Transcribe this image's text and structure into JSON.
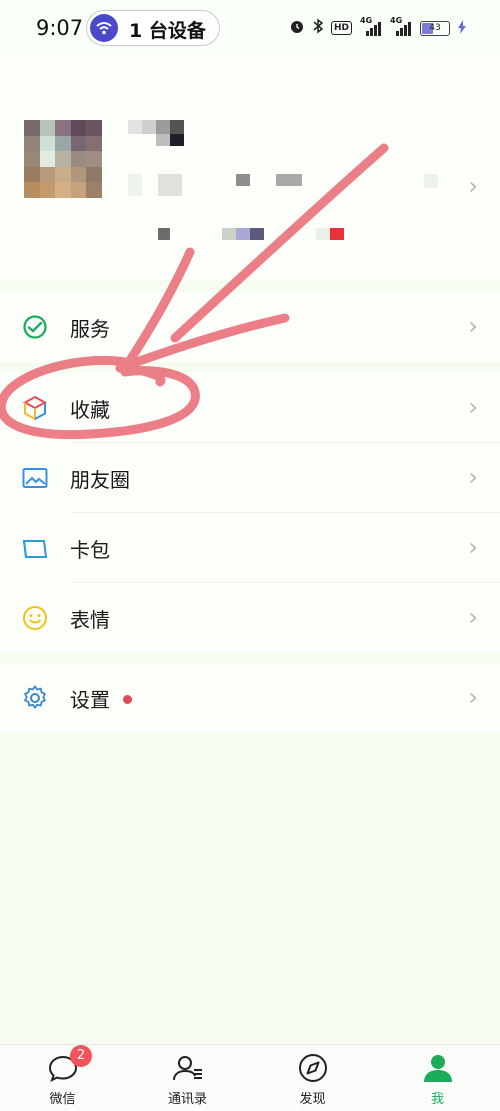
{
  "status_bar": {
    "time": "9:07",
    "device_pill": "1 台设备",
    "network_badge": "HD",
    "signal_1": "4G",
    "signal_2": "4G",
    "battery": "43"
  },
  "menu": {
    "group1": [
      {
        "label": "服务",
        "icon": "wechat-pay-check-icon"
      }
    ],
    "group2": [
      {
        "label": "收藏",
        "icon": "favorites-cube-icon"
      },
      {
        "label": "朋友圈",
        "icon": "moments-picture-icon"
      },
      {
        "label": "卡包",
        "icon": "card-wallet-icon"
      },
      {
        "label": "表情",
        "icon": "sticker-smile-icon"
      }
    ],
    "group3": [
      {
        "label": "设置",
        "icon": "gear-icon",
        "has_dot": true
      }
    ]
  },
  "tabbar": {
    "tabs": [
      {
        "label": "微信",
        "icon": "chat-bubble-icon",
        "badge": "2"
      },
      {
        "label": "通讯录",
        "icon": "contacts-icon"
      },
      {
        "label": "发现",
        "icon": "compass-icon"
      },
      {
        "label": "我",
        "icon": "person-icon",
        "active": true
      }
    ]
  },
  "colors": {
    "accent_green": "#1aad5a",
    "badge_red": "#f2535b",
    "annotation_red": "#e86873",
    "page_bg": "#f6fdf0"
  }
}
